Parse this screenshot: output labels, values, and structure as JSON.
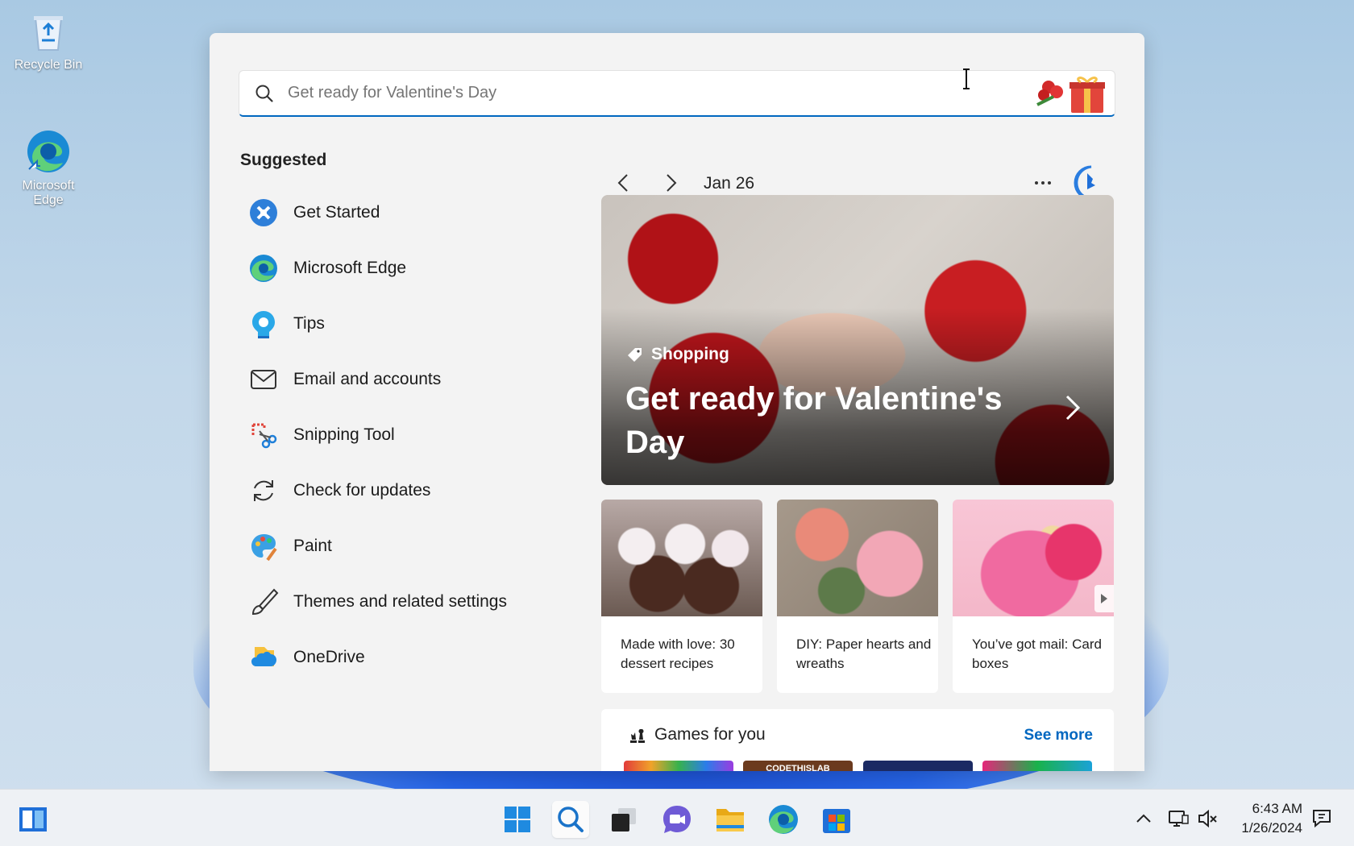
{
  "desktop": {
    "icons": [
      {
        "label": "Recycle Bin",
        "icon": "recycle-bin-icon"
      },
      {
        "label": "Microsoft Edge",
        "icon": "edge-icon"
      }
    ]
  },
  "search": {
    "placeholder": "Get ready for Valentine's Day",
    "value": ""
  },
  "suggested": {
    "title": "Suggested",
    "items": [
      {
        "label": "Get Started",
        "icon": "get-started-icon"
      },
      {
        "label": "Microsoft Edge",
        "icon": "edge-icon"
      },
      {
        "label": "Tips",
        "icon": "tips-icon"
      },
      {
        "label": "Email and accounts",
        "icon": "mail-icon"
      },
      {
        "label": "Snipping Tool",
        "icon": "snipping-tool-icon"
      },
      {
        "label": "Check for updates",
        "icon": "refresh-icon"
      },
      {
        "label": "Paint",
        "icon": "paint-icon"
      },
      {
        "label": "Themes and related settings",
        "icon": "brush-icon"
      },
      {
        "label": "OneDrive",
        "icon": "onedrive-icon"
      }
    ]
  },
  "highlights": {
    "date": "Jan 26",
    "hero": {
      "category": "Shopping",
      "headline": "Get ready for Valentine's Day"
    },
    "cards": [
      {
        "caption": "Made with love: 30 dessert recipes"
      },
      {
        "caption": "DIY: Paper hearts and wreaths"
      },
      {
        "caption": "You’ve got mail: Card boxes"
      }
    ],
    "games": {
      "title": "Games for you",
      "see_more": "See more",
      "thumb2_text": "CODETHISLAB"
    }
  },
  "taskbar": {
    "apps": [
      "widgets-icon",
      "start-icon",
      "search-icon",
      "task-view-icon",
      "chat-icon",
      "file-explorer-icon",
      "edge-icon",
      "store-icon"
    ],
    "time": "6:43 AM",
    "date": "1/26/2024"
  },
  "colors": {
    "accent": "#0067c0",
    "panel_bg": "#f3f3f3",
    "taskbar_bg": "#eef1f5"
  }
}
